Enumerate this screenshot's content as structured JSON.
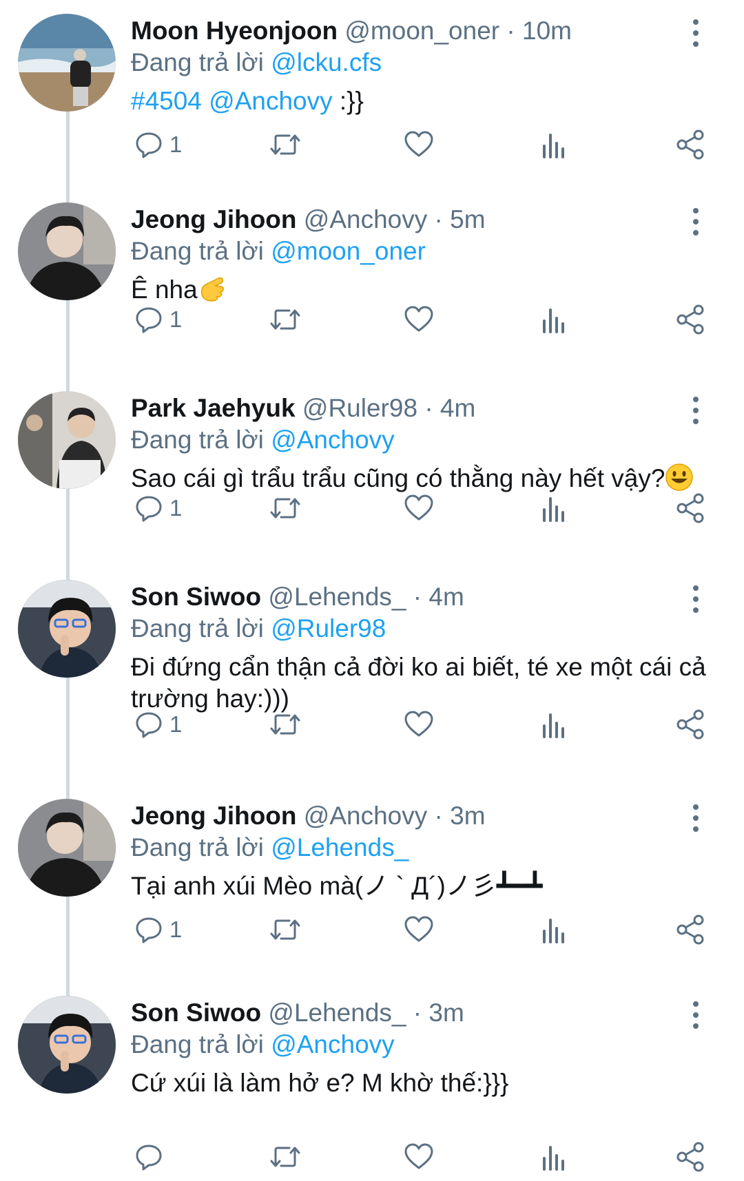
{
  "tweets": [
    {
      "name": "Moon Hyeonjoon",
      "handle": "@moon_oner",
      "time": "10m",
      "reply_prefix": "Đang trả lời",
      "reply_to": "@lcku.cfs",
      "body": ":}}",
      "body_tags": "#4504 @Anchovy",
      "reply_count": "1"
    },
    {
      "name": "Jeong Jihoon",
      "handle": "@Anchovy",
      "time": "5m",
      "reply_prefix": "Đang trả lời",
      "reply_to": "@moon_oner",
      "body": "Ê nha",
      "reply_count": "1"
    },
    {
      "name": "Park Jaehyuk",
      "handle": "@Ruler98",
      "time": "4m",
      "reply_prefix": "Đang trả lời",
      "reply_to": "@Anchovy",
      "body": "Sao cái gì trẩu trẩu cũng có thằng này hết vậy?",
      "reply_count": "1"
    },
    {
      "name": "Son Siwoo",
      "handle": "@Lehends_",
      "time": "4m",
      "reply_prefix": "Đang trả lời",
      "reply_to": "@Ruler98",
      "body": "Đi đứng cẩn thận cả đời ko ai biết, té xe một cái cả trường hay:)))",
      "reply_count": "1"
    },
    {
      "name": "Jeong Jihoon",
      "handle": "@Anchovy",
      "time": "3m",
      "reply_prefix": "Đang trả lời",
      "reply_to": "@Lehends_",
      "body": "Tại anh xúi Mèo mà(ノ ` Д´)ノ彡┻━┻",
      "reply_count": "1"
    },
    {
      "name": "Son Siwoo",
      "handle": "@Lehends_",
      "time": "3m",
      "reply_prefix": "Đang trả lời",
      "reply_to": "@Anchovy",
      "body": "Cứ xúi là làm hở e? M khờ thế:}}}",
      "reply_count": ""
    }
  ],
  "separator": "·",
  "colors": {
    "accent": "#1da1f2",
    "secondary_text": "#5b7083",
    "thread_line": "#cfd9de"
  },
  "icons": [
    "reply-icon",
    "retweet-icon",
    "like-icon",
    "analytics-icon",
    "share-icon",
    "more-options-icon"
  ]
}
